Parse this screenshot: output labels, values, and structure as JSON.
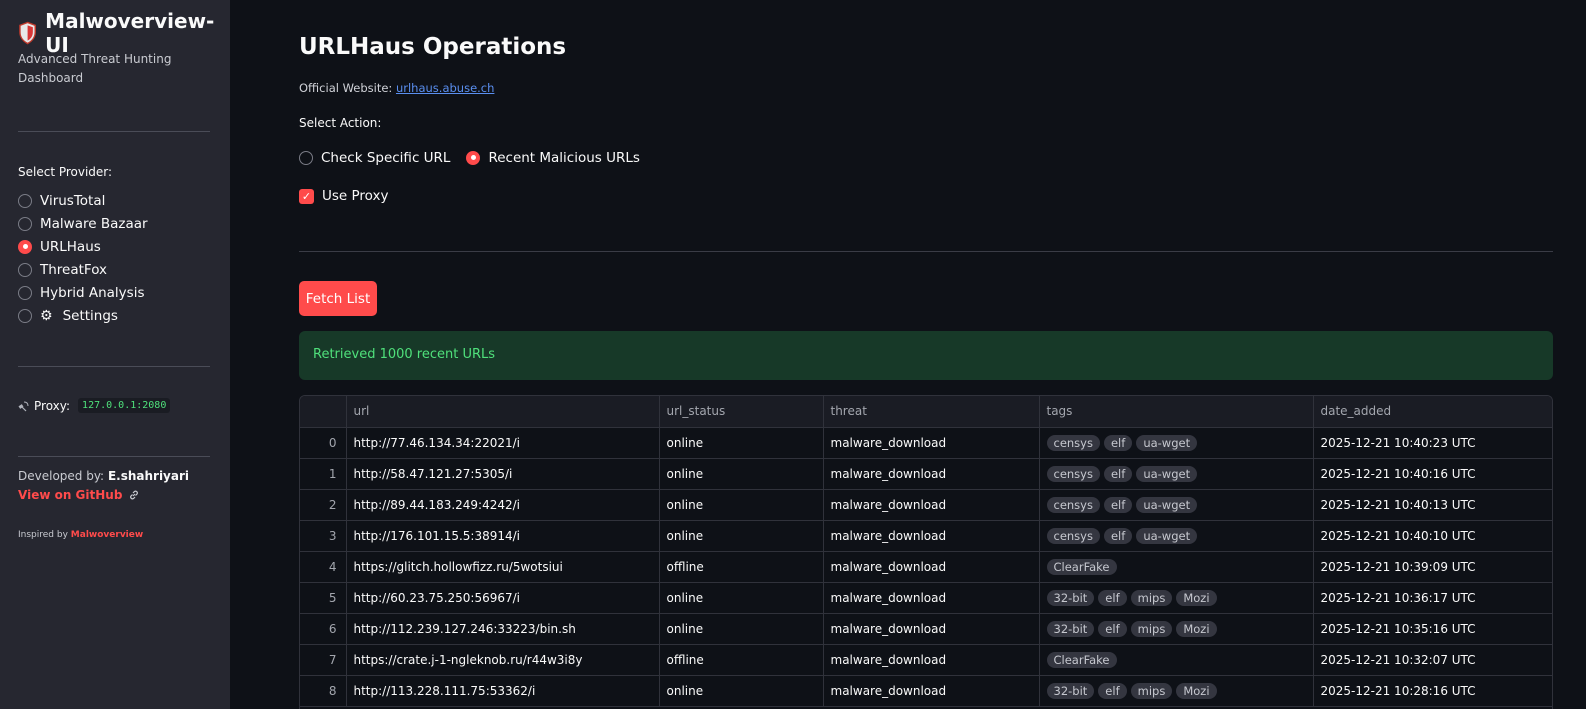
{
  "sidebar": {
    "app_title": "Malwoverview-UI",
    "subtitle": "Advanced Threat Hunting Dashboard",
    "provider_label": "Select Provider:",
    "providers": [
      {
        "label": "VirusTotal",
        "selected": false
      },
      {
        "label": "Malware Bazaar",
        "selected": false
      },
      {
        "label": "URLHaus",
        "selected": true
      },
      {
        "label": "ThreatFox",
        "selected": false
      },
      {
        "label": "Hybrid Analysis",
        "selected": false
      },
      {
        "label": "Settings",
        "selected": false,
        "icon": "gear-icon"
      }
    ],
    "proxy_label": "Proxy:",
    "proxy_value": "127.0.0.1:2080",
    "developed_by_label": "Developed by:",
    "developer": "E.shahriyari",
    "github_label": "View on GitHub",
    "inspired_label": "Inspired by",
    "inspired_name": "Malwoverview"
  },
  "main": {
    "title": "URLHaus Operations",
    "website_label": "Official Website:",
    "website_link": "urlhaus.abuse.ch",
    "action_label": "Select Action:",
    "actions": [
      {
        "label": "Check Specific URL",
        "selected": false
      },
      {
        "label": "Recent Malicious URLs",
        "selected": true
      }
    ],
    "use_proxy_label": "Use Proxy",
    "use_proxy_checked": true,
    "fetch_button": "Fetch List",
    "success_message": "Retrieved 1000 recent URLs"
  },
  "table": {
    "columns": [
      "",
      "url",
      "url_status",
      "threat",
      "tags",
      "date_added"
    ],
    "rows": [
      {
        "idx": "0",
        "url": "http://77.46.134.34:22021/i",
        "url_status": "online",
        "threat": "malware_download",
        "tags": [
          "censys",
          "elf",
          "ua-wget"
        ],
        "date_added": "2025-12-21 10:40:23 UTC"
      },
      {
        "idx": "1",
        "url": "http://58.47.121.27:5305/i",
        "url_status": "online",
        "threat": "malware_download",
        "tags": [
          "censys",
          "elf",
          "ua-wget"
        ],
        "date_added": "2025-12-21 10:40:16 UTC"
      },
      {
        "idx": "2",
        "url": "http://89.44.183.249:4242/i",
        "url_status": "online",
        "threat": "malware_download",
        "tags": [
          "censys",
          "elf",
          "ua-wget"
        ],
        "date_added": "2025-12-21 10:40:13 UTC"
      },
      {
        "idx": "3",
        "url": "http://176.101.15.5:38914/i",
        "url_status": "online",
        "threat": "malware_download",
        "tags": [
          "censys",
          "elf",
          "ua-wget"
        ],
        "date_added": "2025-12-21 10:40:10 UTC"
      },
      {
        "idx": "4",
        "url": "https://glitch.hollowfizz.ru/5wotsiui",
        "url_status": "offline",
        "threat": "malware_download",
        "tags": [
          "ClearFake"
        ],
        "date_added": "2025-12-21 10:39:09 UTC"
      },
      {
        "idx": "5",
        "url": "http://60.23.75.250:56967/i",
        "url_status": "online",
        "threat": "malware_download",
        "tags": [
          "32-bit",
          "elf",
          "mips",
          "Mozi"
        ],
        "date_added": "2025-12-21 10:36:17 UTC"
      },
      {
        "idx": "6",
        "url": "http://112.239.127.246:33223/bin.sh",
        "url_status": "online",
        "threat": "malware_download",
        "tags": [
          "32-bit",
          "elf",
          "mips",
          "Mozi"
        ],
        "date_added": "2025-12-21 10:35:16 UTC"
      },
      {
        "idx": "7",
        "url": "https://crate.j-1-ngleknob.ru/r44w3i8y",
        "url_status": "offline",
        "threat": "malware_download",
        "tags": [
          "ClearFake"
        ],
        "date_added": "2025-12-21 10:32:07 UTC"
      },
      {
        "idx": "8",
        "url": "http://113.228.111.75:53362/i",
        "url_status": "online",
        "threat": "malware_download",
        "tags": [
          "32-bit",
          "elf",
          "mips",
          "Mozi"
        ],
        "date_added": "2025-12-21 10:28:16 UTC"
      }
    ]
  },
  "colors": {
    "accent": "#ff4b4b",
    "success_bg": "#173928",
    "success_text": "#4fe07b",
    "link": "#5a8ff0"
  }
}
